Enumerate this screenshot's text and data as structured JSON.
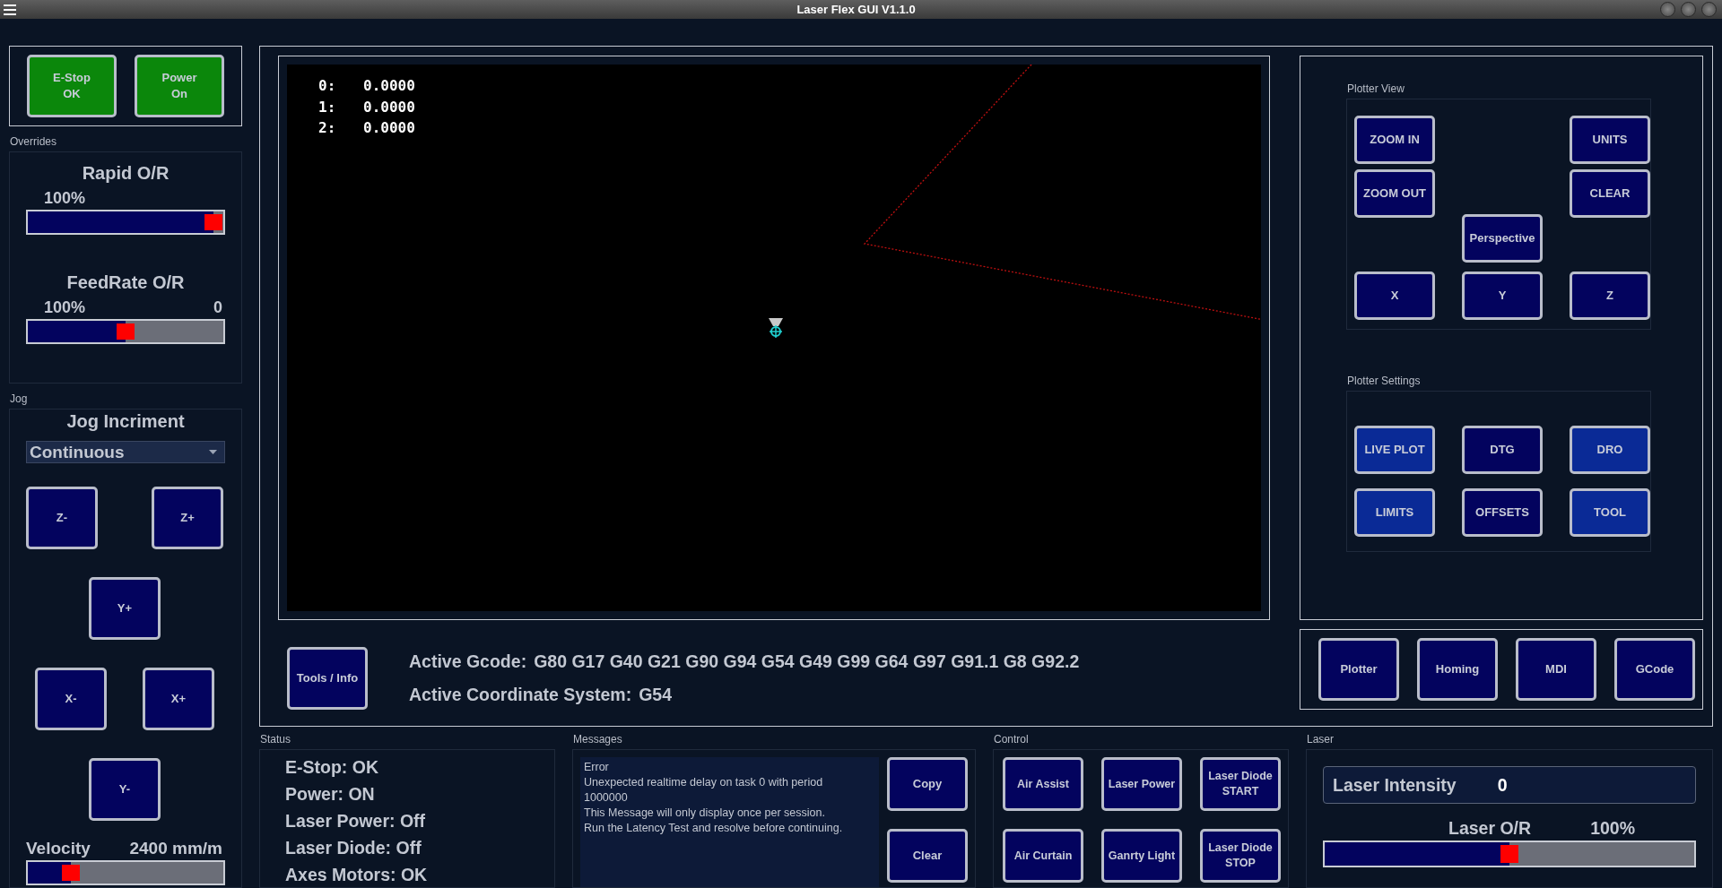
{
  "window": {
    "title": "Laser Flex GUI V1.1.0"
  },
  "machine_buttons": [
    {
      "lines": [
        "E-Stop",
        "OK"
      ],
      "on": true
    },
    {
      "lines": [
        "Power",
        "On"
      ],
      "on": true
    }
  ],
  "overrides": {
    "label": "Overrides",
    "sliders": [
      {
        "title": "Rapid O/R",
        "value": "100%",
        "level": 0.95
      },
      {
        "title": "FeedRate O/R",
        "value": "100%",
        "reading": "0",
        "level": 0.5
      }
    ]
  },
  "jog": {
    "label": "Jog",
    "title": "Jog Incriment",
    "increment": "Continuous",
    "buttons": [
      "Z-",
      "Z+",
      "Y+",
      "X-",
      "X+",
      "Y-"
    ],
    "velocity": {
      "label": "Velocity",
      "reading": "2400 mm/m",
      "level": 0.22
    }
  },
  "dro": [
    {
      "axis": "0:",
      "value": "0.0000"
    },
    {
      "axis": "1:",
      "value": "0.0000"
    },
    {
      "axis": "2:",
      "value": "0.0000"
    }
  ],
  "tools_button": "Tools / Info",
  "active_gcode": {
    "label": "Active Gcode:",
    "value": "G80 G17 G40 G21 G90 G94 G54 G49 G99 G64 G97 G91.1 G8 G92.2"
  },
  "coordinate_system": {
    "label": "Active Coordinate System:",
    "value": "G54"
  },
  "plotter_view": {
    "label": "Plotter View",
    "buttons": [
      "ZOOM IN",
      "UNITS",
      "ZOOM OUT",
      "CLEAR",
      "Perspective",
      "X",
      "Y",
      "Z"
    ]
  },
  "plotter_settings": {
    "label": "Plotter Settings",
    "buttons": [
      {
        "label": "LIVE PLOT",
        "on": true
      },
      {
        "label": "DTG",
        "on": false
      },
      {
        "label": "DRO",
        "on": true
      },
      {
        "label": "LIMITS",
        "on": true
      },
      {
        "label": "OFFSETS",
        "on": false
      },
      {
        "label": "TOOL",
        "on": true
      }
    ]
  },
  "modes": [
    "Plotter",
    "Homing",
    "MDI",
    "GCode"
  ],
  "status": {
    "label": "Status",
    "lines": [
      "E-Stop: OK",
      "Power: ON",
      "Laser Power: Off",
      "Laser Diode: Off",
      "Axes Motors: OK"
    ]
  },
  "messages": {
    "label": "Messages",
    "lines": [
      "Error",
      "Unexpected realtime delay on task 0 with period",
      "1000000",
      "This Message will only display once per session.",
      "Run the Latency Test and resolve before continuing."
    ],
    "buttons": [
      "Copy",
      "Clear"
    ]
  },
  "control": {
    "label": "Control",
    "buttons": [
      {
        "lines": [
          "Air Assist"
        ]
      },
      {
        "lines": [
          "Laser Power"
        ]
      },
      {
        "lines": [
          "Laser Diode",
          "START"
        ]
      },
      {
        "lines": [
          "Air Curtain"
        ]
      },
      {
        "lines": [
          "Ganrty Light"
        ]
      },
      {
        "lines": [
          "Laser Diode",
          "STOP"
        ]
      }
    ]
  },
  "laser": {
    "label": "Laser",
    "intensity": {
      "label": "Laser Intensity",
      "value": "0"
    },
    "override": {
      "label": "Laser O/R",
      "reading": "100%",
      "level": 0.5
    }
  }
}
